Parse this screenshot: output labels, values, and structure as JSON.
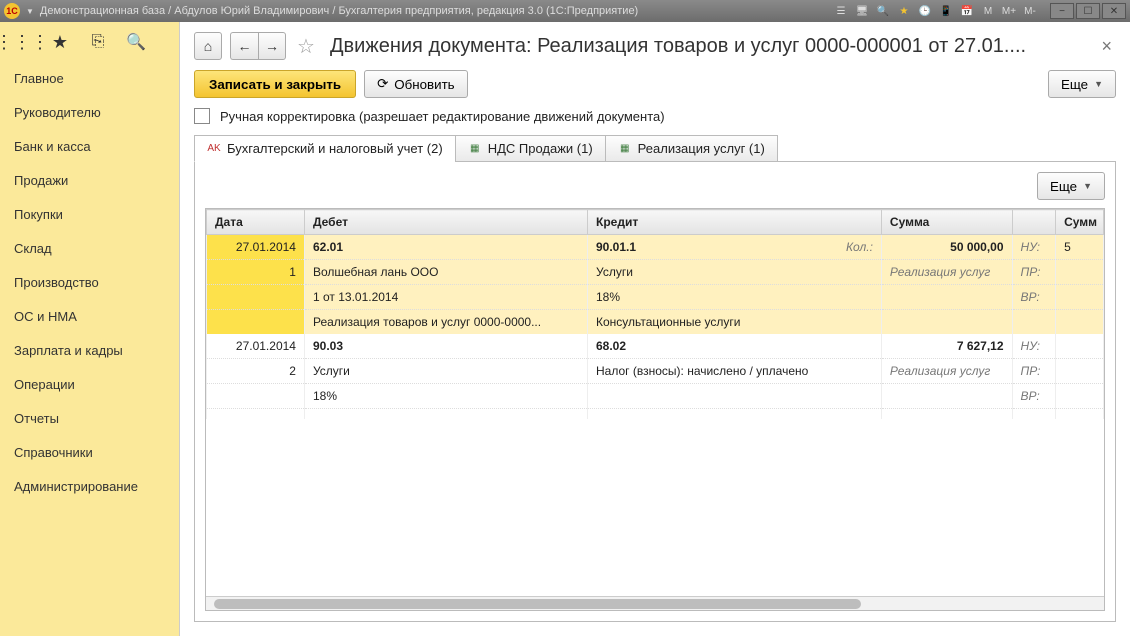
{
  "titlebar": {
    "title": "Демонстрационная база / Абдулов Юрий Владимирович / Бухгалтерия предприятия, редакция 3.0  (1С:Предприятие)",
    "logo_label": "1C"
  },
  "sidebar": {
    "items": [
      {
        "label": "Главное"
      },
      {
        "label": "Руководителю"
      },
      {
        "label": "Банк и касса"
      },
      {
        "label": "Продажи"
      },
      {
        "label": "Покупки"
      },
      {
        "label": "Склад"
      },
      {
        "label": "Производство"
      },
      {
        "label": "ОС и НМА"
      },
      {
        "label": "Зарплата и кадры"
      },
      {
        "label": "Операции"
      },
      {
        "label": "Отчеты"
      },
      {
        "label": "Справочники"
      },
      {
        "label": "Администрирование"
      }
    ]
  },
  "header": {
    "title": "Движения документа: Реализация товаров и услуг 0000-000001 от 27.01...."
  },
  "commands": {
    "save_close": "Записать и закрыть",
    "refresh": "Обновить",
    "more": "Еще"
  },
  "manual_edit": {
    "label": "Ручная корректировка (разрешает редактирование движений документа)"
  },
  "tabs": [
    {
      "label": "Бухгалтерский и налоговый учет (2)",
      "icon": "AK"
    },
    {
      "label": "НДС Продажи (1)",
      "icon": "▦"
    },
    {
      "label": "Реализация услуг (1)",
      "icon": "▦"
    }
  ],
  "grid": {
    "columns": [
      "Дата",
      "Дебет",
      "Кредит",
      "Сумма",
      "",
      "Сумм"
    ],
    "rows": [
      {
        "date": "27.01.2014",
        "idx": "1",
        "debit_lines": [
          "62.01",
          "Волшебная лань ООО",
          "1 от 13.01.2014",
          "Реализация товаров и услуг 0000-0000..."
        ],
        "credit_lines": [
          "90.01.1",
          "Услуги",
          "18%",
          "Консультационные услуги"
        ],
        "credit_extra": "Кол.:",
        "sum": "50 000,00",
        "sum_text": "Реализация услуг",
        "tags": [
          "НУ:",
          "ПР:",
          "ВР:"
        ],
        "tail": "5",
        "selected": true
      },
      {
        "date": "27.01.2014",
        "idx": "2",
        "debit_lines": [
          "90.03",
          "Услуги",
          "18%"
        ],
        "credit_lines": [
          "68.02",
          "Налог (взносы): начислено / уплачено"
        ],
        "sum": "7 627,12",
        "sum_text": "Реализация услуг",
        "tags": [
          "НУ:",
          "ПР:",
          "ВР:"
        ],
        "selected": false
      }
    ]
  }
}
